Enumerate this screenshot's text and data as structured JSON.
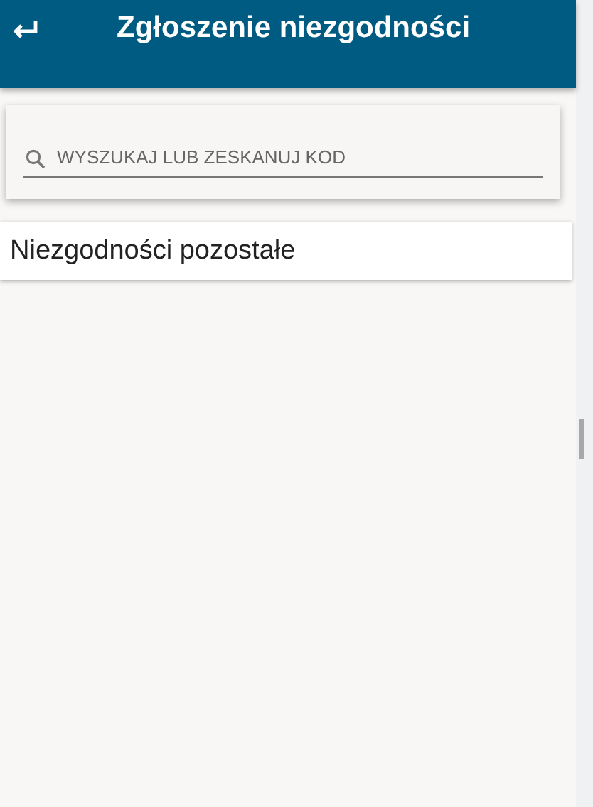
{
  "header": {
    "title": "Zgłoszenie niezgodności"
  },
  "search": {
    "placeholder": "WYSZUKAJ LUB ZESKANUJ KOD"
  },
  "items": [
    {
      "label": "Niezgodności pozostałe"
    }
  ]
}
